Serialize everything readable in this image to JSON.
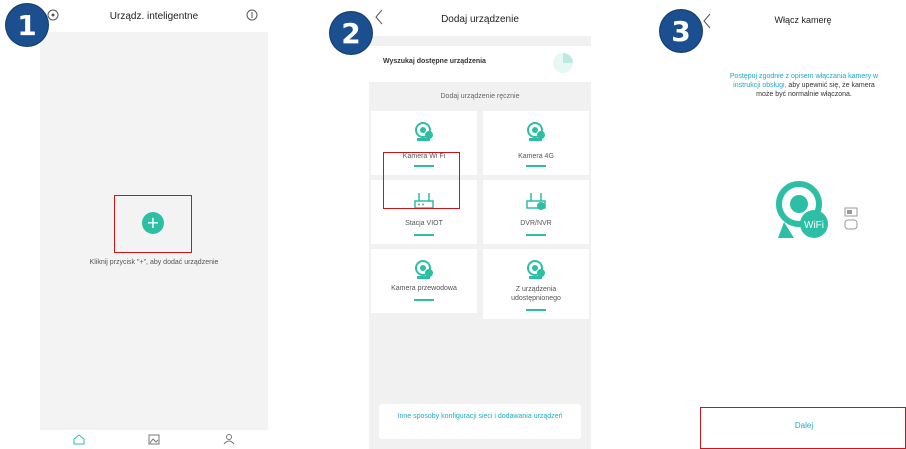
{
  "steps": [
    "1",
    "2",
    "3"
  ],
  "colors": {
    "accent": "#2dbfa5",
    "highlight": "#d0121b",
    "badge": "#1b4f8f",
    "link": "#1ea9c8"
  },
  "screen1": {
    "title": "Urządz. inteligentne",
    "add_symbol": "+",
    "hint": "Kliknij przycisk \"+\", aby dodać urządzenie",
    "tabs": [
      {
        "icon": "home-icon"
      },
      {
        "icon": "gallery-icon"
      },
      {
        "icon": "profile-icon"
      }
    ]
  },
  "screen2": {
    "title": "Dodaj urządzenie",
    "search_label": "Wyszukaj dostępne urządzenia",
    "manual_label": "Dodaj urządzenie ręcznie",
    "tiles": [
      {
        "label": "Kamera Wi Fi",
        "icon": "wifi-camera-icon"
      },
      {
        "label": "Kamera 4G",
        "icon": "4g-camera-icon"
      },
      {
        "label": "Stacja VIOT",
        "icon": "router-icon"
      },
      {
        "label": "DVR/NVR",
        "icon": "dvr-icon"
      },
      {
        "label": "Kamera przewodowa",
        "icon": "wired-camera-icon"
      },
      {
        "label": "Z urządzenia udostępnionego",
        "icon": "shared-camera-icon"
      }
    ],
    "other_methods": "Inne sposoby konfiguracji sieci i dodawania urządzeń"
  },
  "screen3": {
    "title": "Włącz kamerę",
    "desc_teal": "Postępuj zgodnie z opisem włączania kamery w instrukcji obsługi,",
    "desc_dark": " aby upewnić się, że kamera może być normalnie włączona.",
    "wifi_badge": "WiFi",
    "next_label": "Dalej"
  }
}
